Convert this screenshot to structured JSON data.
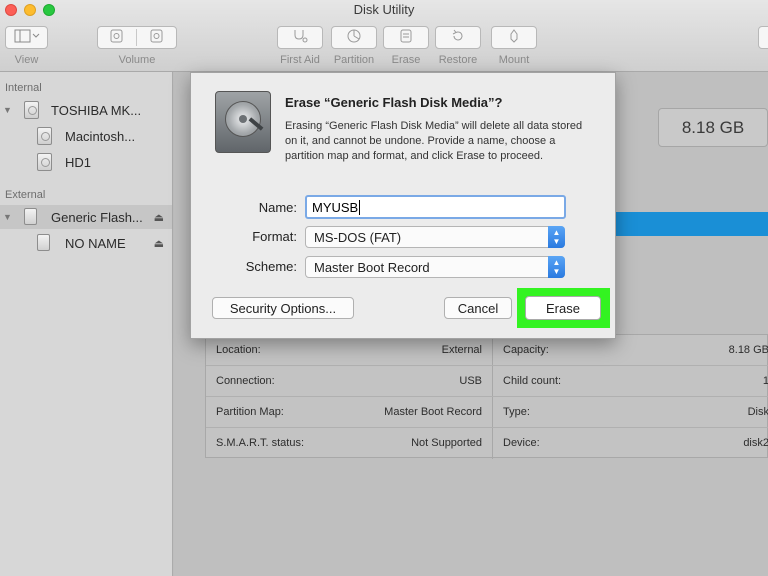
{
  "window": {
    "title": "Disk Utility"
  },
  "toolbar": {
    "view_label": "View",
    "volume_label": "Volume",
    "first_aid_label": "First Aid",
    "partition_label": "Partition",
    "erase_label": "Erase",
    "restore_label": "Restore",
    "mount_label": "Mount"
  },
  "sidebar": {
    "internal_header": "Internal",
    "external_header": "External",
    "items": [
      {
        "label": "TOSHIBA MK..."
      },
      {
        "label": "Macintosh..."
      },
      {
        "label": "HD1"
      },
      {
        "label": "Generic Flash..."
      },
      {
        "label": "NO NAME"
      }
    ],
    "eject_symbol": "⏏"
  },
  "main": {
    "capacity_display": "8.18 GB",
    "usage_bar_color": "#1a8fd6",
    "info": [
      {
        "key": "Location:",
        "value": "External",
        "key2": "Capacity:",
        "value2": "8.18 GB"
      },
      {
        "key": "Connection:",
        "value": "USB",
        "key2": "Child count:",
        "value2": "1"
      },
      {
        "key": "Partition Map:",
        "value": "Master Boot Record",
        "key2": "Type:",
        "value2": "Disk"
      },
      {
        "key": "S.M.A.R.T. status:",
        "value": "Not Supported",
        "key2": "Device:",
        "value2": "disk2"
      }
    ]
  },
  "dialog": {
    "title": "Erase “Generic Flash Disk Media”?",
    "message": "Erasing “Generic Flash Disk Media” will delete all data stored on it, and cannot be undone. Provide a name, choose a partition map and format, and click Erase to proceed.",
    "name_label": "Name:",
    "name_value": "MYUSB",
    "format_label": "Format:",
    "format_value": "MS-DOS (FAT)",
    "scheme_label": "Scheme:",
    "scheme_value": "Master Boot Record",
    "security_options_label": "Security Options...",
    "cancel_label": "Cancel",
    "erase_label": "Erase",
    "highlight_color": "#33f321"
  }
}
